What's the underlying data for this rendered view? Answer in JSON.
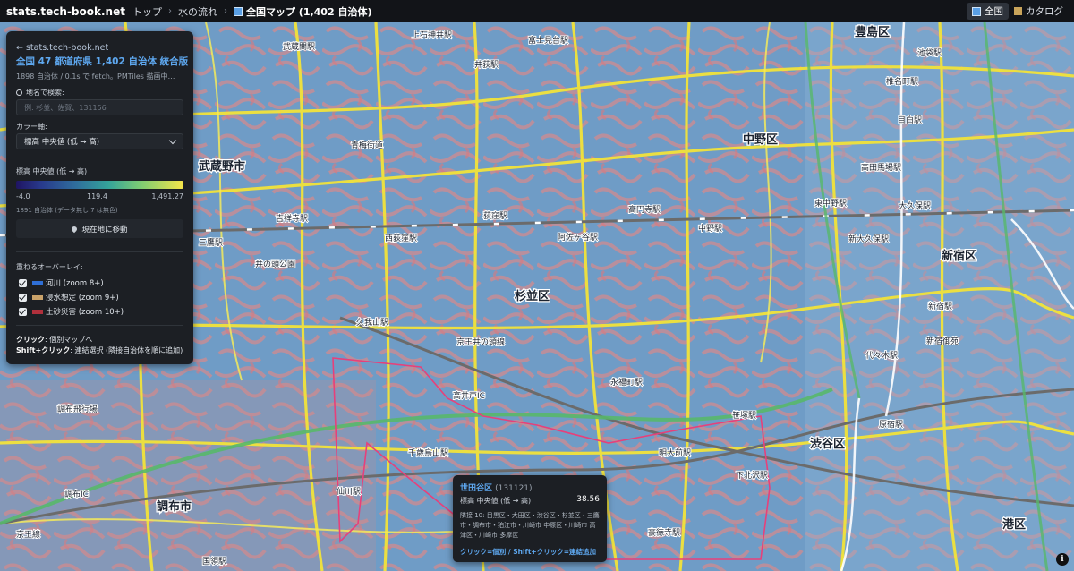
{
  "header": {
    "brand": "stats.tech-book.net",
    "breadcrumbs": [
      "トップ",
      "水の流れ"
    ],
    "current": "全国マップ (1,402 自治体)",
    "nav_all": "全国",
    "nav_catalog": "カタログ"
  },
  "panel": {
    "back_link": "← stats.tech-book.net",
    "title": "全国 47 都道府県 1,402 自治体 統合版",
    "subtitle": "1898 自治体 / 0.1s で fetch。PMTiles 描画中…",
    "search_label": "地名で検索:",
    "search_placeholder": "例: 杉並、佐賀、131156",
    "color_axis_label": "カラー軸:",
    "color_axis_value": "標高 中央値 (低 → 高)",
    "legend_title": "標高 中央値 (低 → 高)",
    "legend_min": "-4.0",
    "legend_mid": "119.4",
    "legend_max": "1,491.27",
    "count_note": "1891 自治体 (データ無し 7 は無色)",
    "locate_button": "現在地に移動",
    "overlay_label": "重ねるオーバーレイ:",
    "overlays": [
      {
        "label": "河川 (zoom 8+)",
        "color": "#2f6fd6",
        "checked": true
      },
      {
        "label": "浸水想定 (zoom 9+)",
        "color": "#c9a26a",
        "checked": true
      },
      {
        "label": "土砂災害 (zoom 10+)",
        "color": "#b0303c",
        "checked": true
      }
    ],
    "help_click_key": "クリック",
    "help_click_text": ": 個別マップへ",
    "help_shift_key": "Shift+クリック",
    "help_shift_text": ": 連結選択 (隣接自治体を順に追加)"
  },
  "tooltip": {
    "name": "世田谷区",
    "code": "(131121)",
    "metric": "標高 中央値 (低 → 高)",
    "value": "38.56",
    "neighbors": "隣接 10: 目黒区・大田区・渋谷区・杉並区・三鷹市・調布市・狛江市・川崎市 中原区・川崎市 高津区・川崎市 多摩区",
    "hint": "クリック=個別 / Shift+クリック=連結追加"
  },
  "map": {
    "labels": [
      {
        "text": "豊島区",
        "big": true
      },
      {
        "text": "中野区",
        "big": true
      },
      {
        "text": "武蔵野市",
        "big": true
      },
      {
        "text": "杉並区",
        "big": true
      },
      {
        "text": "新宿区",
        "big": true
      },
      {
        "text": "渋谷区",
        "big": true
      },
      {
        "text": "調布市",
        "big": true
      },
      {
        "text": "港区",
        "big": true
      },
      {
        "text": "池袋駅"
      },
      {
        "text": "椎名町駅"
      },
      {
        "text": "目白駅"
      },
      {
        "text": "高田馬場駅"
      },
      {
        "text": "東中野駅"
      },
      {
        "text": "大久保駅"
      },
      {
        "text": "新大久保駅"
      },
      {
        "text": "新宿駅"
      },
      {
        "text": "新宿御苑"
      },
      {
        "text": "代々木駅"
      },
      {
        "text": "原宿駅"
      },
      {
        "text": "笹塚駅"
      },
      {
        "text": "明大前駅"
      },
      {
        "text": "下北沢駅"
      },
      {
        "text": "豪徳寺駅"
      },
      {
        "text": "千歳烏山駅"
      },
      {
        "text": "仙川駅"
      },
      {
        "text": "国領駅"
      },
      {
        "text": "吉祥寺駅"
      },
      {
        "text": "西荻窪駅"
      },
      {
        "text": "荻窪駅"
      },
      {
        "text": "阿佐ヶ谷駅"
      },
      {
        "text": "高円寺駅"
      },
      {
        "text": "中野駅"
      },
      {
        "text": "井の頭公園"
      },
      {
        "text": "久我山駅"
      },
      {
        "text": "京王井の頭線"
      },
      {
        "text": "三鷹駅"
      },
      {
        "text": "富士見台駅"
      },
      {
        "text": "井荻駅"
      },
      {
        "text": "上石神井駅"
      },
      {
        "text": "武蔵関駅"
      },
      {
        "text": "青梅街道"
      },
      {
        "text": "調布IC"
      },
      {
        "text": "高井戸IC"
      },
      {
        "text": "京王線"
      },
      {
        "text": "調布飛行場"
      },
      {
        "text": "永福町駅"
      }
    ]
  }
}
